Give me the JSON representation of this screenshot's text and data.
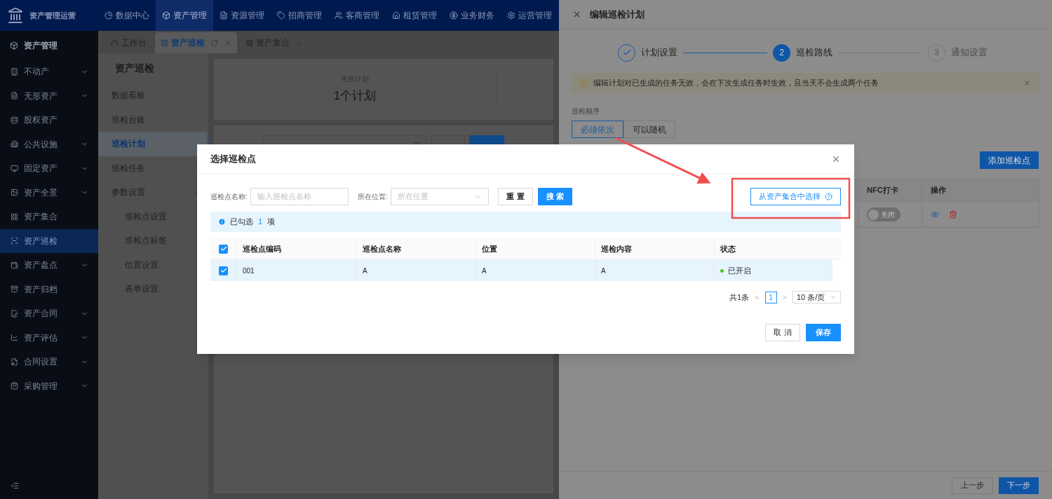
{
  "app": {
    "title": "资产管理运营"
  },
  "top_nav": [
    {
      "label": "数据中心",
      "selected": false
    },
    {
      "label": "资产管理",
      "selected": true
    },
    {
      "label": "资源管理",
      "selected": false
    },
    {
      "label": "招商管理",
      "selected": false
    },
    {
      "label": "客商管理",
      "selected": false
    },
    {
      "label": "租赁管理",
      "selected": false
    },
    {
      "label": "业务财务",
      "selected": false
    },
    {
      "label": "运营管理",
      "selected": false
    }
  ],
  "sidebar": {
    "header": "资产管理",
    "items": [
      {
        "label": "不动产",
        "expandable": true,
        "selected": false
      },
      {
        "label": "无形资产",
        "expandable": true,
        "selected": false
      },
      {
        "label": "股权资产",
        "expandable": false,
        "selected": false
      },
      {
        "label": "公共设施",
        "expandable": true,
        "selected": false
      },
      {
        "label": "固定资产",
        "expandable": true,
        "selected": false
      },
      {
        "label": "资产全景",
        "expandable": true,
        "selected": false
      },
      {
        "label": "资产集合",
        "expandable": false,
        "selected": false
      },
      {
        "label": "资产巡检",
        "expandable": false,
        "selected": true
      },
      {
        "label": "资产盘点",
        "expandable": true,
        "selected": false
      },
      {
        "label": "资产归档",
        "expandable": false,
        "selected": false
      },
      {
        "label": "资产合同",
        "expandable": true,
        "selected": false
      },
      {
        "label": "资产评估",
        "expandable": true,
        "selected": false
      },
      {
        "label": "合同设置",
        "expandable": true,
        "selected": false
      },
      {
        "label": "采购管理",
        "expandable": true,
        "selected": false
      }
    ]
  },
  "tabs": [
    {
      "label": "工作台",
      "selected": false,
      "closable": false
    },
    {
      "label": "资产巡检",
      "selected": true,
      "closable": true
    },
    {
      "label": "资产集合",
      "selected": false,
      "closable": true
    }
  ],
  "sub_nav": {
    "title": "资产巡检",
    "items": [
      {
        "label": "数据看板",
        "selected": false
      },
      {
        "label": "巡检台账",
        "selected": false
      },
      {
        "label": "巡检计划",
        "selected": true
      },
      {
        "label": "巡检任务",
        "selected": false
      },
      {
        "label": "参数设置",
        "selected": false,
        "expanded": true,
        "children": [
          {
            "label": "巡检点设置",
            "selected": false
          },
          {
            "label": "巡检点标签",
            "selected": false
          },
          {
            "label": "位置设置",
            "selected": false
          },
          {
            "label": "表单设置",
            "selected": false
          }
        ]
      }
    ]
  },
  "stat_card": {
    "label": "生效计划",
    "value": "1个计划"
  },
  "drawer": {
    "title": "编辑巡检计划",
    "steps": [
      {
        "label": "计划设置",
        "kind": "done"
      },
      {
        "number": "2",
        "label": "巡检路线",
        "kind": "active"
      },
      {
        "number": "3",
        "label": "通知设置",
        "kind": "waiting"
      }
    ],
    "alert": "编辑计划对已生成的任务无效，会在下次生成任务时生效，且当天不会生成两个任务",
    "order_label": "巡检顺序",
    "order_options": [
      {
        "label": "必须依次",
        "selected": true
      },
      {
        "label": "可以随机",
        "selected": false
      }
    ],
    "add_button": "添加巡检点",
    "table": {
      "columns": [
        "NFC打卡",
        "操作"
      ],
      "rows": [
        {
          "nfc": {
            "on": false,
            "label": "关闭"
          }
        }
      ]
    },
    "prev_button": "上一步",
    "next_button": "下一步"
  },
  "modal": {
    "title": "选择巡检点",
    "name_label": "巡检点名称:",
    "name_placeholder": "输入巡检点名称",
    "location_label": "所在位置:",
    "location_placeholder": "所在位置",
    "reset": "重 置",
    "search": "搜 索",
    "collection_button": "从资产集合中选择",
    "selection": {
      "prefix": "已勾选",
      "count": "1",
      "suffix": "项"
    },
    "table": {
      "all_checked": true,
      "columns": [
        "巡检点编码",
        "巡检点名称",
        "位置",
        "巡检内容",
        "状态"
      ],
      "rows": [
        {
          "checked": true,
          "cells": [
            "001",
            "A",
            "A",
            "A"
          ],
          "status": "已开启",
          "color": "#52c41a"
        }
      ]
    },
    "pagination": {
      "total": "共1条",
      "prev": "<",
      "pages": [
        {
          "label": "1",
          "selected": true
        }
      ],
      "next": ">",
      "page_size": "10 条/页"
    },
    "cancel": "取 消",
    "save": "保存"
  }
}
